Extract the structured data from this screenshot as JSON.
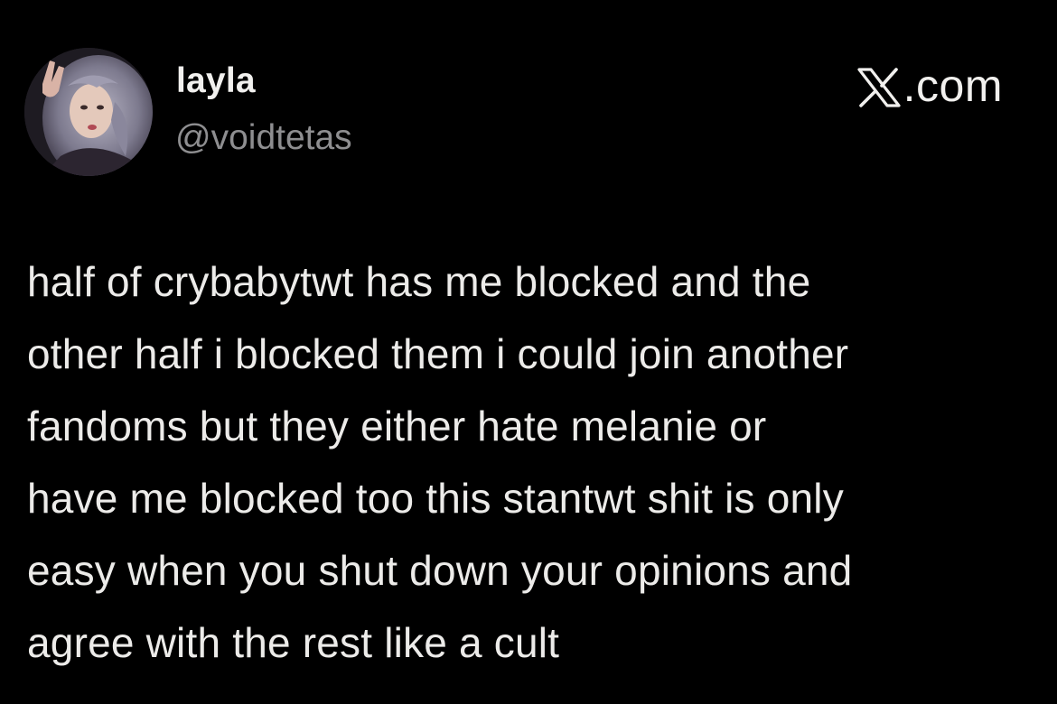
{
  "user": {
    "display_name": "layla",
    "handle": "@voidtetas"
  },
  "source": {
    "icon": "x-logo-icon",
    "domain_suffix": ".com"
  },
  "tweet": {
    "lines": [
      "half of crybabytwt has me blocked and the",
      "other half i blocked them i could join another",
      "fandoms but they either hate melanie or",
      "have me blocked too this stantwt shit is only",
      "easy when you shut down your opinions and",
      "agree with the rest like a cult"
    ]
  },
  "colors": {
    "background": "#000000",
    "text": "#ecebe9",
    "handle": "#8e8e90"
  }
}
